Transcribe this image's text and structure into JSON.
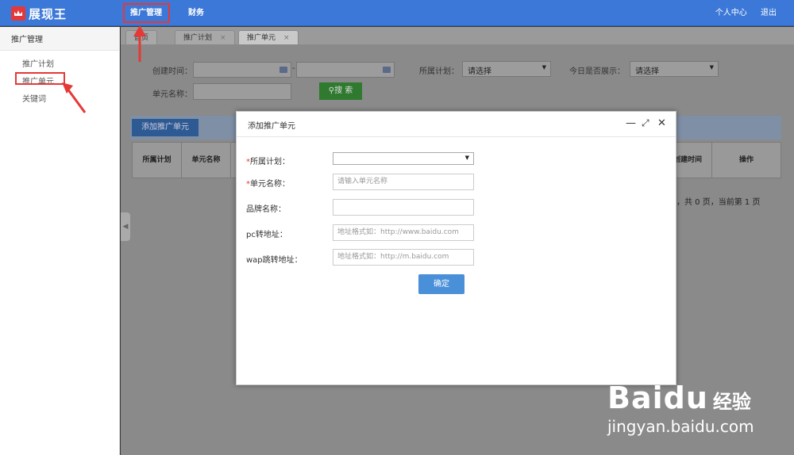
{
  "app": {
    "name": "展现王",
    "logo_icon": "crown-icon"
  },
  "topnav": {
    "promotion": "推广管理",
    "finance": "财务"
  },
  "user_menu": {
    "personal": "个人中心",
    "logout": "退出"
  },
  "sidebar": {
    "title": "推广管理",
    "items": [
      {
        "label": "推广计划"
      },
      {
        "label": "推广单元"
      },
      {
        "label": "关键词"
      }
    ]
  },
  "tabs": [
    {
      "label": "首页"
    },
    {
      "label": "推广计划",
      "close": "×"
    },
    {
      "label": "推广单元",
      "close": "×"
    }
  ],
  "filters": {
    "create_time_label": "创建时间：",
    "date_sep": "-",
    "plan_label": "所属计划：",
    "plan_value": "请选择",
    "show_today_label": "今日是否展示：",
    "show_today_value": "请选择",
    "unit_name_label": "单元名称：",
    "search_label": "搜 索"
  },
  "add_button": "添加推广单元",
  "table": {
    "headers": [
      "所属计划",
      "单元名称",
      "创建时间",
      "操作"
    ]
  },
  "pager": "，共 0 页，当前第  1 页",
  "modal": {
    "title": "添加推广单元",
    "minimize": "—",
    "maximize": "⤢",
    "close": "✕",
    "fields": {
      "plan": {
        "label": "所属计划：",
        "required": "*"
      },
      "unit_name": {
        "label": "单元名称：",
        "required": "*",
        "placeholder": "请输入单元名称"
      },
      "brand": {
        "label": "品牌名称："
      },
      "pc_url": {
        "label": "pc转地址：",
        "placeholder": "地址格式如：http://www.baidu.com"
      },
      "wap_url": {
        "label": "wap跳转地址：",
        "placeholder": "地址格式如：http://m.baidu.com"
      }
    },
    "ok": "确定"
  },
  "watermark": {
    "brand": "Baidu",
    "sub": "经验",
    "url": "jingyan.baidu.com"
  },
  "colors": {
    "topbar": "#3c78d8",
    "highlight": "#e53935",
    "ok": "#4a90d9",
    "search": "#2f7a2f"
  }
}
